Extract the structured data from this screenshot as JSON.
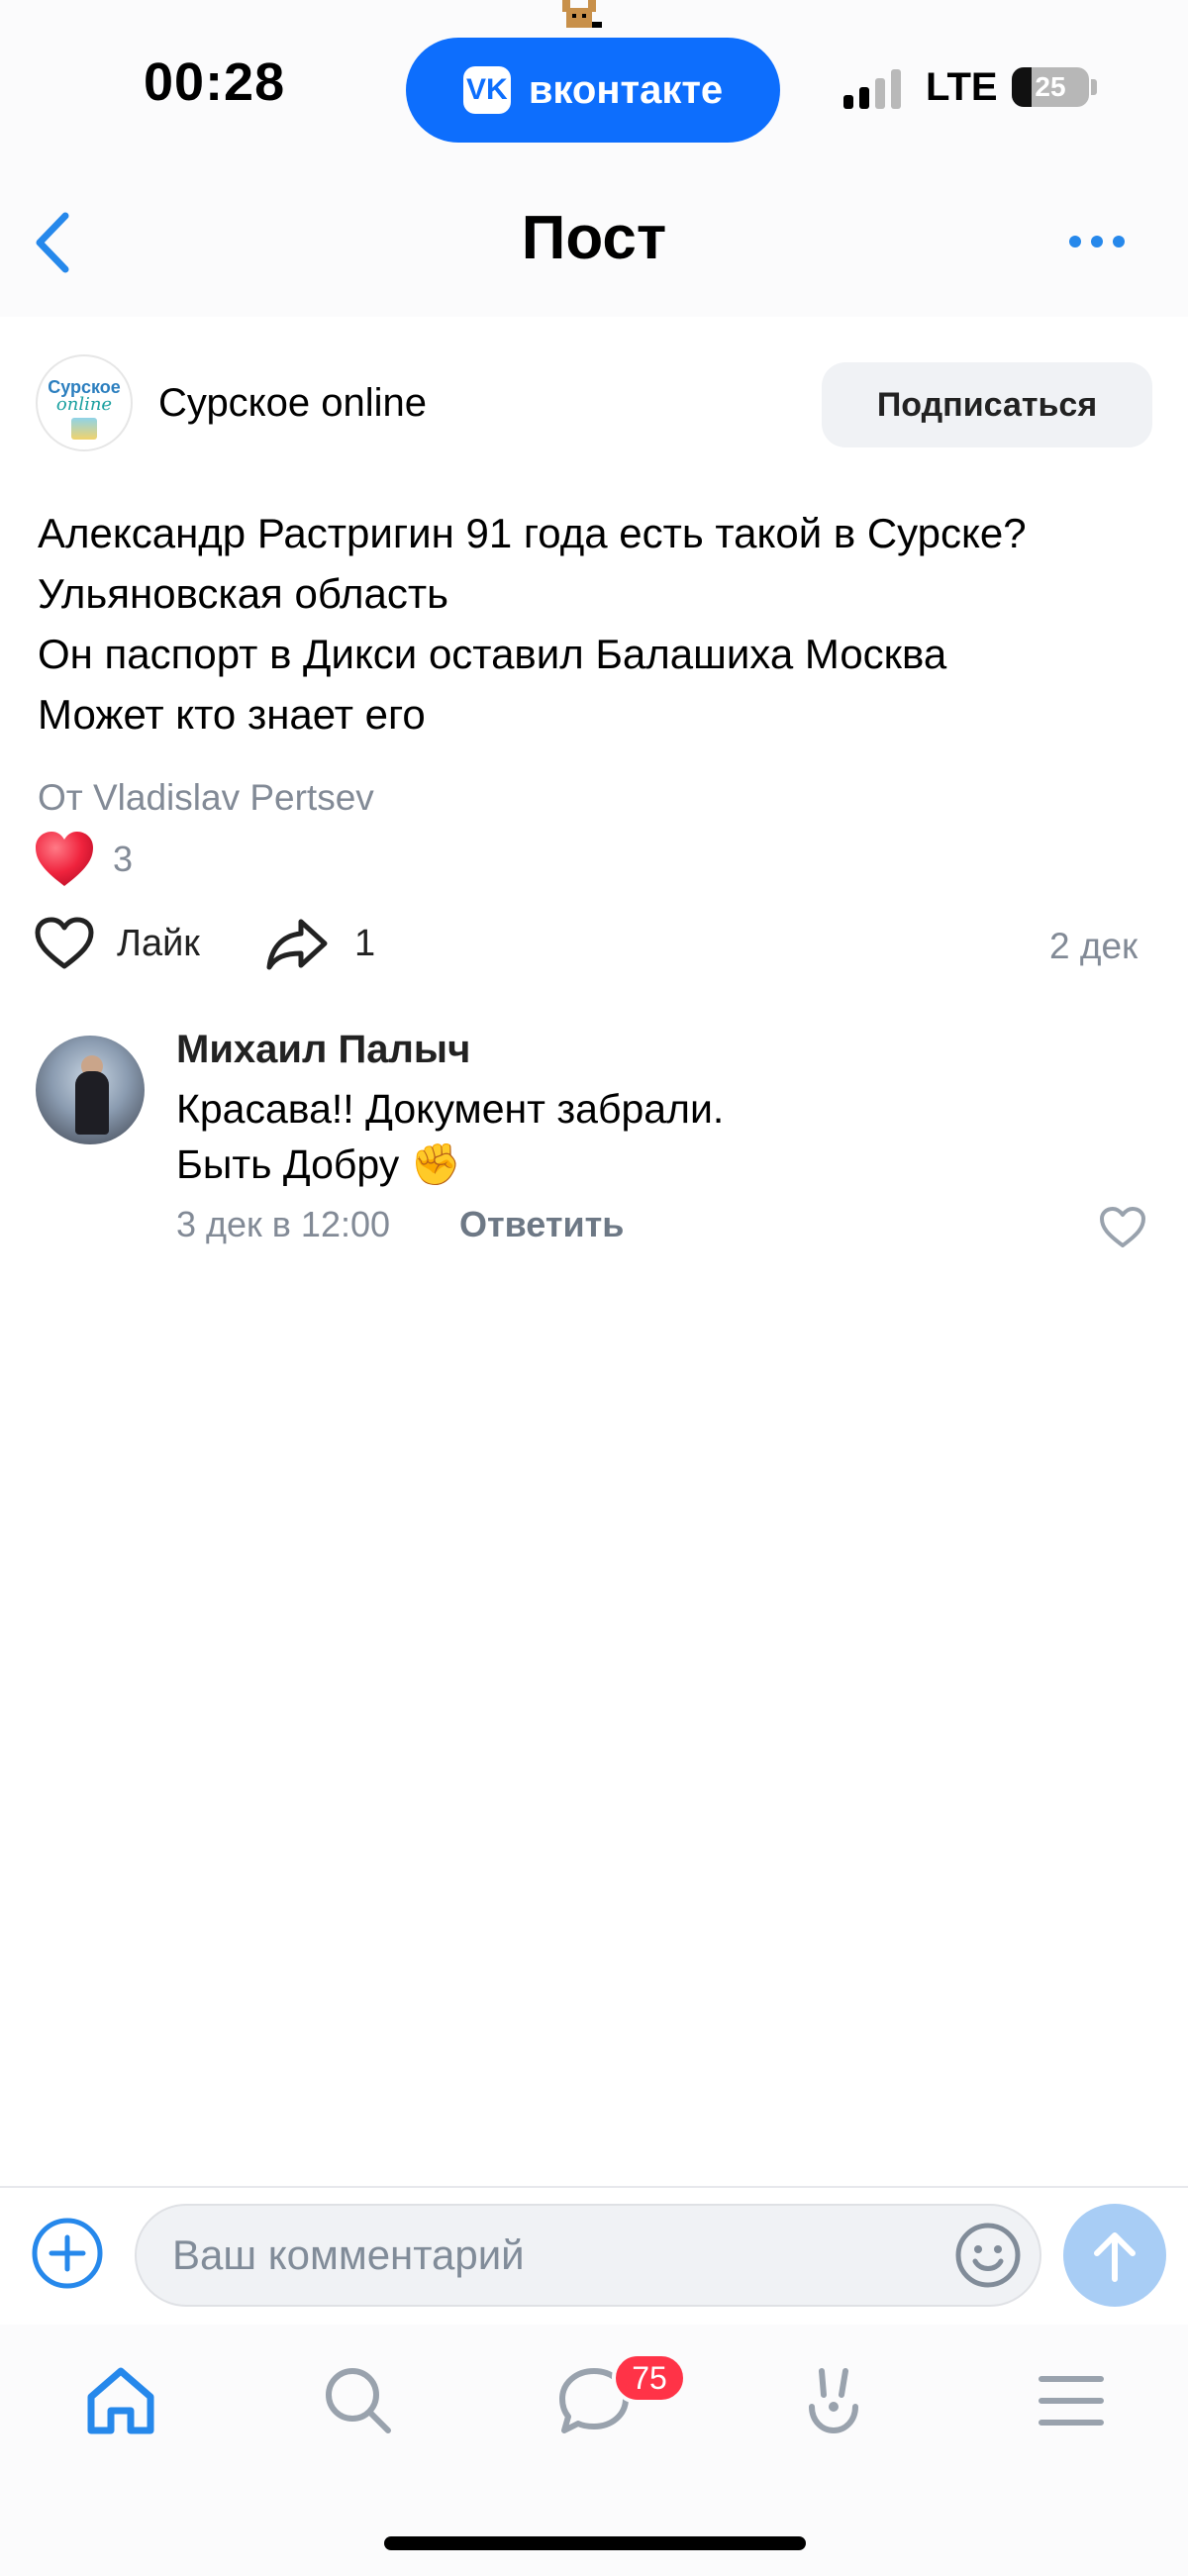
{
  "status_bar": {
    "time": "00:28",
    "app_pill": "вконтакте",
    "app_pill_logo": "VK",
    "network": "LTE",
    "battery_level": "25"
  },
  "header": {
    "title": "Пост"
  },
  "post": {
    "group_name": "Сурское online",
    "group_avatar_text": [
      "Сурское",
      "online"
    ],
    "subscribe_label": "Подписаться",
    "text_lines": [
      "Александр Растригин 91 года есть такой в Сурске?",
      "Ульяновская область",
      "Он паспорт в Дикси оставил Балашиха Москва",
      "Может кто знает его"
    ],
    "author": "От Vladislav Pertsev",
    "reaction_count": "3",
    "like_label": "Лайк",
    "share_count": "1",
    "date": "2 дек"
  },
  "comment": {
    "author": "Михаил Палыч",
    "text_lines": [
      "Красава!! Документ забрали.",
      "Быть Добру ✊"
    ],
    "date": "3 дек в 12:00",
    "reply_label": "Ответить"
  },
  "composer": {
    "placeholder": "Ваш комментарий"
  },
  "tabbar": {
    "messages_badge": "75",
    "items": [
      "home-icon",
      "search-icon",
      "messages-icon",
      "services-icon",
      "menu-icon"
    ]
  },
  "colors": {
    "accent": "#2688eb",
    "vk_blue": "#0d6efd",
    "secondary_text": "#828a96",
    "badge": "#ff3347",
    "send_disabled": "#a8cdf5"
  }
}
